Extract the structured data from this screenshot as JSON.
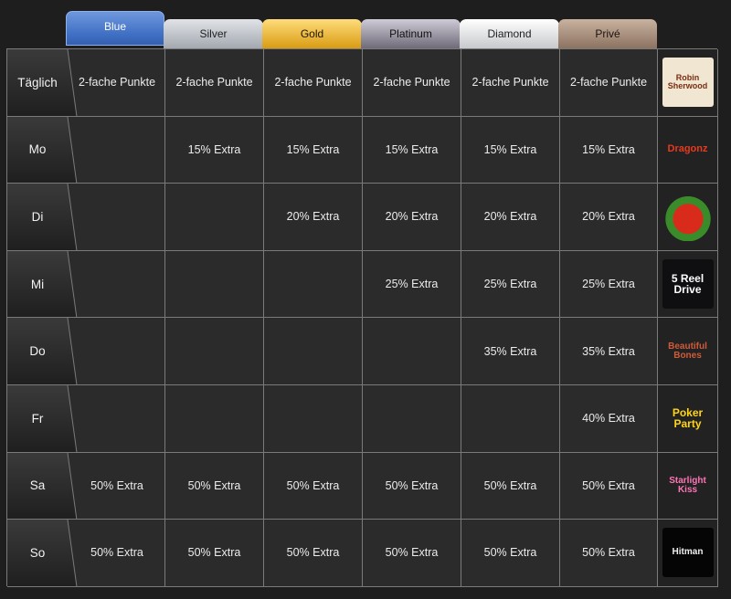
{
  "tiers": [
    "Blue",
    "Silver",
    "Gold",
    "Platinum",
    "Diamond",
    "Privé"
  ],
  "rows": [
    {
      "day": "Täglich",
      "values": [
        "2-fache Punkte",
        "2-fache Punkte",
        "2-fache Punkte",
        "2-fache Punkte",
        "2-fache Punkte",
        "2-fache Punkte"
      ],
      "logo_icon": "robin-of-sherwood-logo-icon",
      "logo_text": "Robin Sherwood"
    },
    {
      "day": "Mo",
      "values": [
        "",
        "15% Extra",
        "15% Extra",
        "15% Extra",
        "15% Extra",
        "15% Extra"
      ],
      "logo_icon": "dragonz-logo-icon",
      "logo_text": "Dragonz"
    },
    {
      "day": "Di",
      "values": [
        "",
        "",
        "20% Extra",
        "20% Extra",
        "20% Extra",
        "20% Extra"
      ],
      "logo_icon": "slot-game-logo-icon",
      "logo_text": ""
    },
    {
      "day": "Mi",
      "values": [
        "",
        "",
        "",
        "25% Extra",
        "25% Extra",
        "25% Extra"
      ],
      "logo_icon": "5-reel-drive-logo-icon",
      "logo_text": "5 Reel Drive"
    },
    {
      "day": "Do",
      "values": [
        "",
        "",
        "",
        "",
        "35% Extra",
        "35% Extra"
      ],
      "logo_icon": "beautiful-bones-logo-icon",
      "logo_text": "Beautiful Bones"
    },
    {
      "day": "Fr",
      "values": [
        "",
        "",
        "",
        "",
        "",
        "40% Extra"
      ],
      "logo_icon": "poker-party-logo-icon",
      "logo_text": "Poker Party"
    },
    {
      "day": "Sa",
      "values": [
        "50% Extra",
        "50% Extra",
        "50% Extra",
        "50% Extra",
        "50% Extra",
        "50% Extra"
      ],
      "logo_icon": "starlight-kiss-logo-icon",
      "logo_text": "Starlight Kiss"
    },
    {
      "day": "So",
      "values": [
        "50% Extra",
        "50% Extra",
        "50% Extra",
        "50% Extra",
        "50% Extra",
        "50% Extra"
      ],
      "logo_icon": "hitman-logo-icon",
      "logo_text": "Hitman"
    }
  ],
  "colors": {
    "blue": "#3f6fc4",
    "silver": "#b8bcc3",
    "gold": "#e8ad22",
    "platinum": "#8a8694",
    "diamond": "#f2f2f2",
    "prive": "#a38a78"
  }
}
